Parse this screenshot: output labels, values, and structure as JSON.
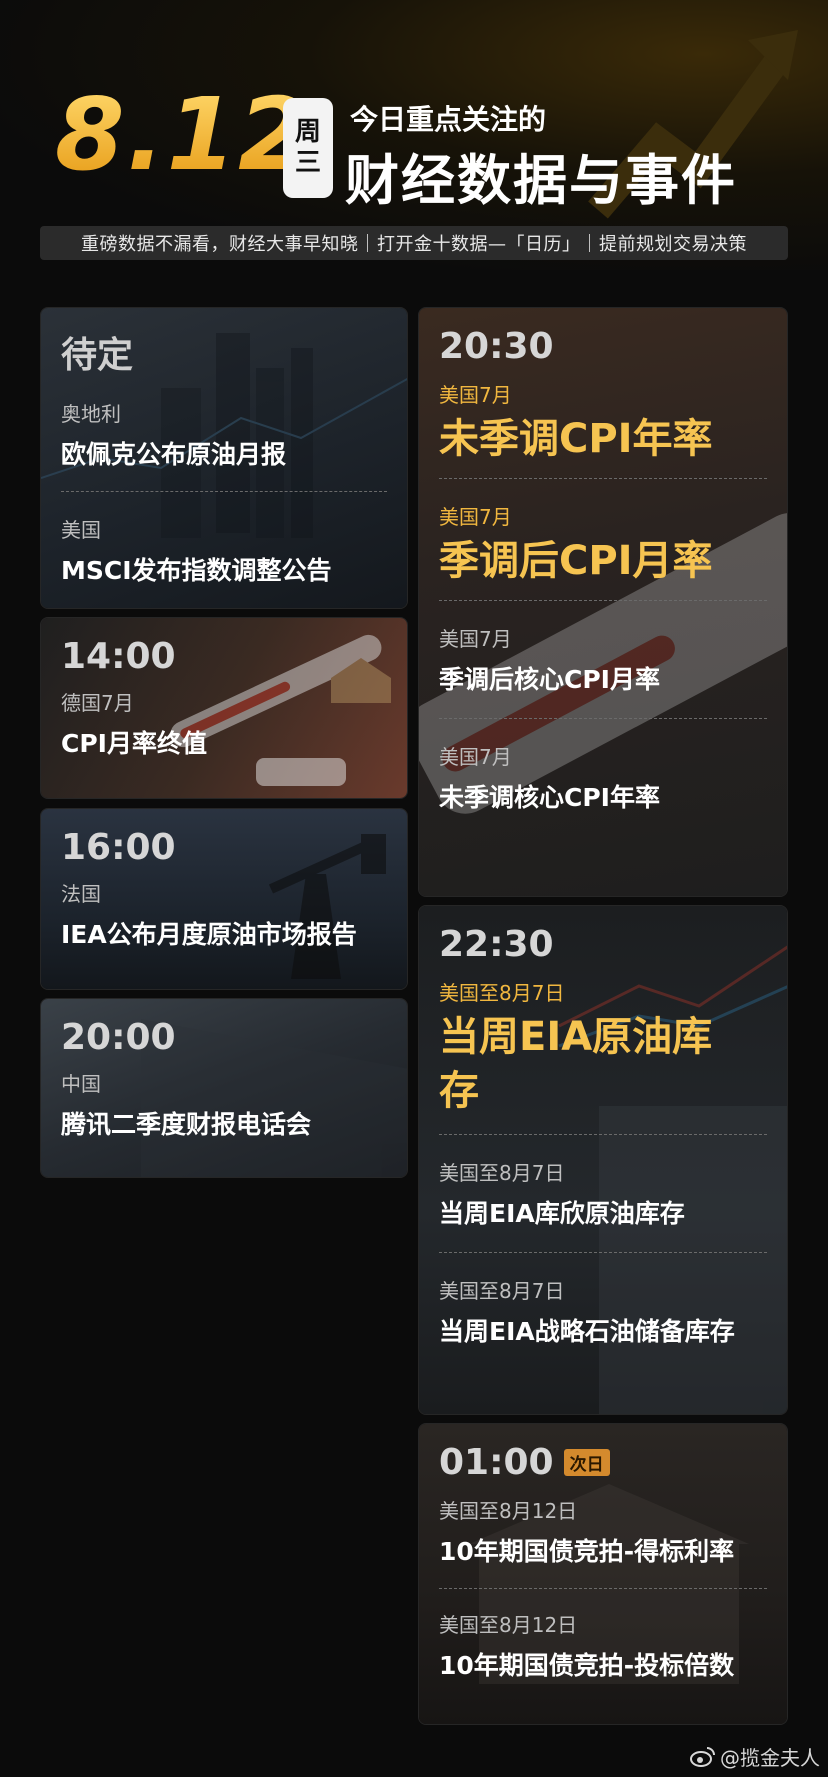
{
  "header": {
    "date": "8.12",
    "weekday_top": "周",
    "weekday_bottom": "三",
    "title_line1": "今日重点关注的",
    "title_line2": "财经数据与事件",
    "subtitle": "重磅数据不漏看，财经大事早知晓｜打开金十数据—「日历」｜提前规划交易决策"
  },
  "left": {
    "pending": {
      "time": "待定",
      "items": [
        {
          "country": "奥地利",
          "event": "欧佩克公布原油月报"
        },
        {
          "country": "美国",
          "event": "MSCI发布指数调整公告"
        }
      ]
    },
    "c1400": {
      "time": "14:00",
      "country": "德国7月",
      "event": "CPI月率终值"
    },
    "c1600": {
      "time": "16:00",
      "country": "法国",
      "event": "IEA公布月度原油市场报告"
    },
    "c2000": {
      "time": "20:00",
      "country": "中国",
      "event": "腾讯二季度财报电话会"
    }
  },
  "right": {
    "c2030": {
      "time": "20:30",
      "items": [
        {
          "country": "美国7月",
          "event": "未季调CPI年率"
        },
        {
          "country": "美国7月",
          "event": "季调后CPI月率"
        },
        {
          "country": "美国7月",
          "event": "季调后核心CPI月率"
        },
        {
          "country": "美国7月",
          "event": "未季调核心CPI年率"
        }
      ]
    },
    "c2230": {
      "time": "22:30",
      "items": [
        {
          "country": "美国至8月7日",
          "event": "当周EIA原油库存"
        },
        {
          "country": "美国至8月7日",
          "event": "当周EIA库欣原油库存"
        },
        {
          "country": "美国至8月7日",
          "event": "当周EIA战略石油储备库存"
        }
      ]
    },
    "c0100": {
      "time": "01:00",
      "badge": "次日",
      "items": [
        {
          "country": "美国至8月12日",
          "event": "10年期国债竞拍-得标利率"
        },
        {
          "country": "美国至8月12日",
          "event": "10年期国债竞拍-投标倍数"
        }
      ]
    }
  },
  "footer": {
    "handle": "@揽金夫人",
    "icon": "weibo-icon"
  },
  "colors": {
    "accent": "#f6c451",
    "background": "#0b0b0b",
    "badge": "#d48a2d"
  }
}
